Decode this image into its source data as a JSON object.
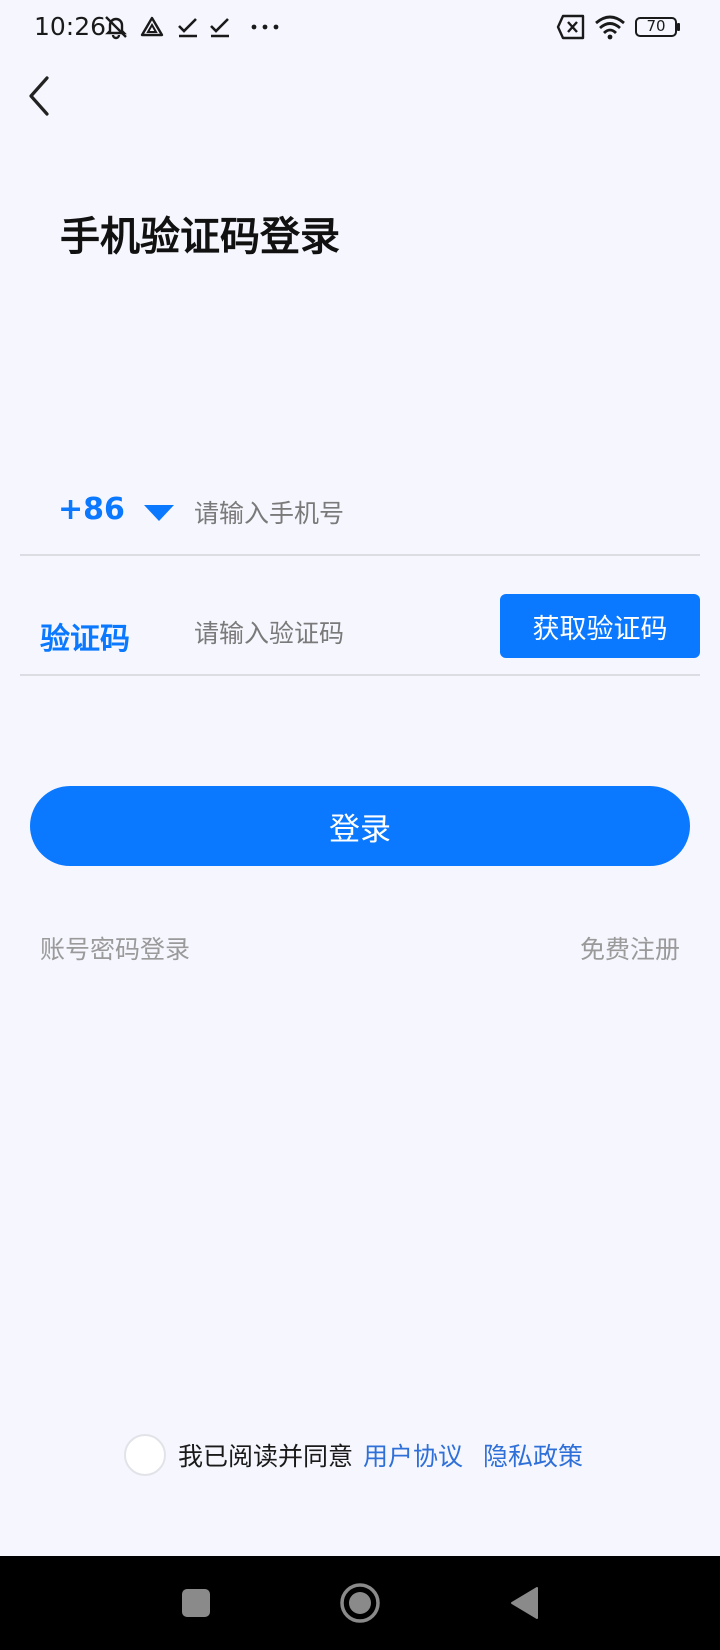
{
  "status_bar": {
    "time": "10:26",
    "battery": "70",
    "icons": [
      "mute-icon",
      "drive-icon",
      "check-icon",
      "check-icon",
      "more-dots-icon",
      "sim-x-icon",
      "wifi-icon",
      "battery-icon"
    ]
  },
  "header": {
    "back_icon": "chevron-left-icon",
    "title": "手机验证码登录"
  },
  "form": {
    "country_code": "+86",
    "phone_placeholder": "请输入手机号",
    "code_label": "验证码",
    "code_placeholder": "请输入验证码",
    "get_code_label": "获取验证码",
    "login_label": "登录"
  },
  "links": {
    "password_login": "账号密码登录",
    "register": "免费注册"
  },
  "agreement": {
    "text": "我已阅读并同意",
    "user_agreement": "用户协议",
    "privacy_policy": "隐私政策"
  },
  "colors": {
    "accent": "#0a78ff",
    "background": "#f6f7fe",
    "link": "#2f6fd8",
    "muted_text": "#9a9a9a"
  }
}
